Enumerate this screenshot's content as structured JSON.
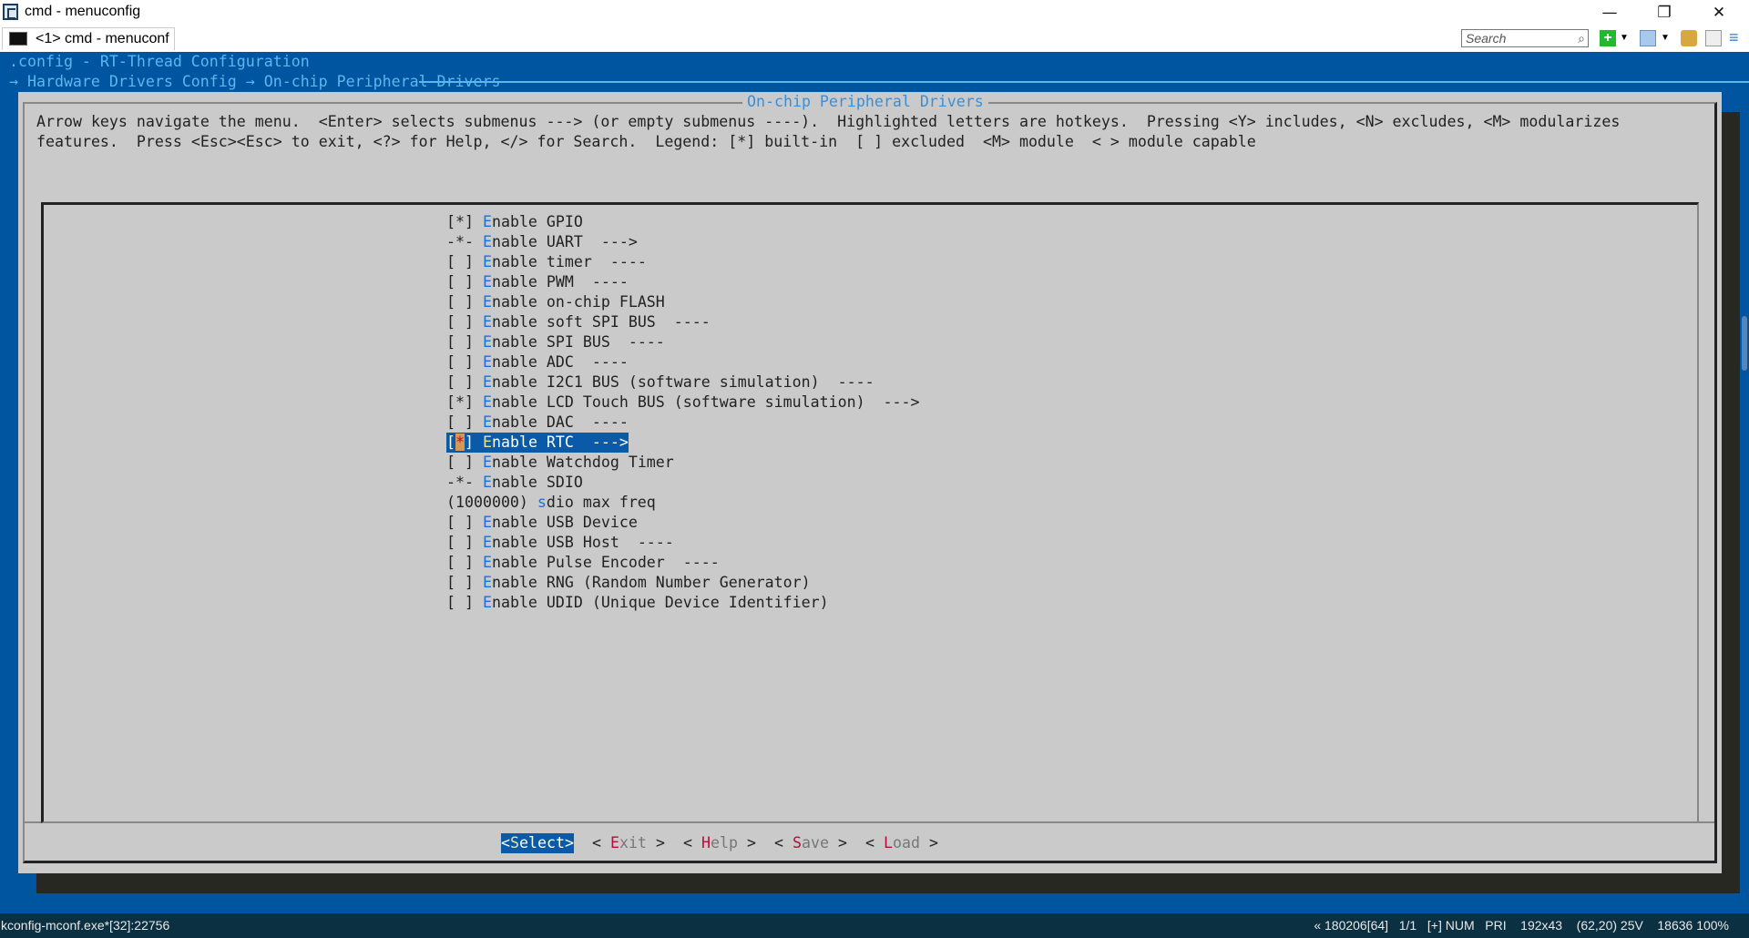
{
  "window": {
    "title": "cmd - menuconfig",
    "tab_label": "<1> cmd - menuconf",
    "search_placeholder": "Search",
    "minimize": "—",
    "restore": "❐",
    "close": "✕"
  },
  "terminal": {
    "config_title": ".config - RT-Thread Configuration",
    "breadcrumb": "→ Hardware Drivers Config → On-chip Peripheral Drivers",
    "dialog_title": "On-chip Peripheral Drivers",
    "help_line1": "Arrow keys navigate the menu.  <Enter> selects submenus ---> (or empty submenus ----).  Highlighted letters are hotkeys.  Pressing <Y> includes, <N> excludes, <M> modularizes",
    "help_line2": "features.  Press <Esc><Esc> to exit, <?> for Help, </> for Search.  Legend: [*] built-in  [ ] excluded  <M> module  < > module capable",
    "selected_index": 11,
    "items": [
      {
        "prefix": "[*] ",
        "hotkey": "E",
        "rest": "nable GPIO"
      },
      {
        "prefix": "-*- ",
        "hotkey": "E",
        "rest": "nable UART  --->"
      },
      {
        "prefix": "[ ] ",
        "hotkey": "E",
        "rest": "nable timer  ----"
      },
      {
        "prefix": "[ ] ",
        "hotkey": "E",
        "rest": "nable PWM  ----"
      },
      {
        "prefix": "[ ] ",
        "hotkey": "E",
        "rest": "nable on-chip FLASH"
      },
      {
        "prefix": "[ ] ",
        "hotkey": "E",
        "rest": "nable soft SPI BUS  ----"
      },
      {
        "prefix": "[ ] ",
        "hotkey": "E",
        "rest": "nable SPI BUS  ----"
      },
      {
        "prefix": "[ ] ",
        "hotkey": "E",
        "rest": "nable ADC  ----"
      },
      {
        "prefix": "[ ] ",
        "hotkey": "E",
        "rest": "nable I2C1 BUS (software simulation)  ----"
      },
      {
        "prefix": "[*] ",
        "hotkey": "E",
        "rest": "nable LCD Touch BUS (software simulation)  --->"
      },
      {
        "prefix": "[ ] ",
        "hotkey": "E",
        "rest": "nable DAC  ----"
      },
      {
        "prefix": "[*] ",
        "hotkey": "E",
        "rest": "nable RTC  --->"
      },
      {
        "prefix": "[ ] ",
        "hotkey": "E",
        "rest": "nable Watchdog Timer"
      },
      {
        "prefix": "-*- ",
        "hotkey": "E",
        "rest": "nable SDIO"
      },
      {
        "prefix": "(1000000) ",
        "hotkey": "s",
        "rest": "dio max freq"
      },
      {
        "prefix": "[ ] ",
        "hotkey": "E",
        "rest": "nable USB Device"
      },
      {
        "prefix": "[ ] ",
        "hotkey": "E",
        "rest": "nable USB Host  ----"
      },
      {
        "prefix": "[ ] ",
        "hotkey": "E",
        "rest": "nable Pulse Encoder  ----"
      },
      {
        "prefix": "[ ] ",
        "hotkey": "E",
        "rest": "nable RNG (Random Number Generator)"
      },
      {
        "prefix": "[ ] ",
        "hotkey": "E",
        "rest": "nable UDID (Unique Device Identifier)"
      }
    ],
    "buttons": [
      {
        "open": "<",
        "hotkey": "S",
        "rest": "elect",
        "close": ">",
        "active": true
      },
      {
        "open": "< ",
        "hotkey": "E",
        "rest": "xit",
        "close": " >",
        "active": false
      },
      {
        "open": "< ",
        "hotkey": "H",
        "rest": "elp",
        "close": " >",
        "active": false
      },
      {
        "open": "< ",
        "hotkey": "S",
        "rest": "ave",
        "close": " >",
        "active": false
      },
      {
        "open": "< ",
        "hotkey": "L",
        "rest": "oad",
        "close": " >",
        "active": false
      }
    ]
  },
  "statusbar": {
    "left": "kconfig-mconf.exe*[32]:22756",
    "right": "« 180206[64]   1/1   [+] NUM   PRI    192x43    (62,20) 25V    18636 100%"
  },
  "colors": {
    "terminal_bg": "#0055a0",
    "dialog_bg": "#cacaca",
    "highlight": "#0b5aa8",
    "hotkey": "#1e6fd8",
    "button_hotkey": "#b0103a"
  }
}
